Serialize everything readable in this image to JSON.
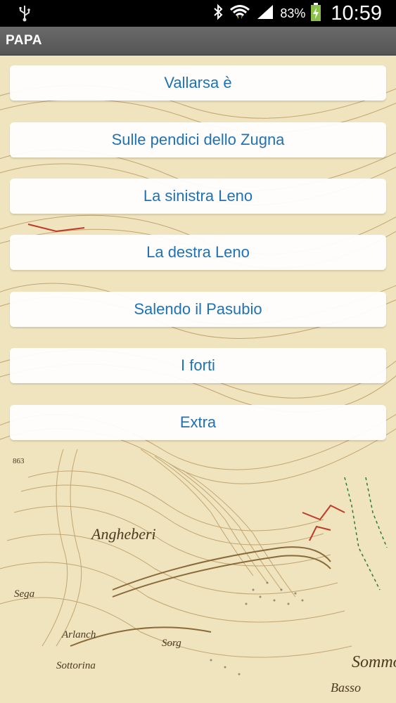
{
  "status_bar": {
    "battery_percent": "83%",
    "time": "10:59",
    "icons": [
      "usb-icon",
      "bluetooth-icon",
      "wifi-icon",
      "signal-icon",
      "battery-icon"
    ]
  },
  "action_bar": {
    "title": "PAPA"
  },
  "menu": {
    "items": [
      {
        "label": "Vallarsa è"
      },
      {
        "label": "Sulle pendici dello Zugna"
      },
      {
        "label": "La sinistra Leno"
      },
      {
        "label": "La destra Leno"
      },
      {
        "label": "Salendo il Pasubio"
      },
      {
        "label": "I forti"
      },
      {
        "label": "Extra"
      }
    ]
  },
  "map_labels": {
    "place_1": "Angheberi",
    "place_2": "Sega",
    "place_3": "Arlanch",
    "place_4": "Sorg",
    "place_5": "Sottorina",
    "place_6": "Sommo",
    "place_7": "Basso",
    "elevation": "863"
  },
  "colors": {
    "menu_text": "#1f72b3",
    "map_paper": "#efe4bd",
    "contour": "#b08a55",
    "road_red": "#c0392b"
  }
}
